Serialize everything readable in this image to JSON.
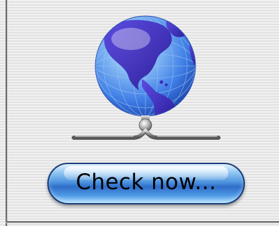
{
  "button": {
    "label": "Check now..."
  },
  "graphic": {
    "icon": "network-globe-icon"
  },
  "colors": {
    "button_blue": "#4f95df",
    "button_border": "#1a3e78",
    "globe_ocean": "#4a86ea",
    "globe_land": "#3b28b8"
  }
}
